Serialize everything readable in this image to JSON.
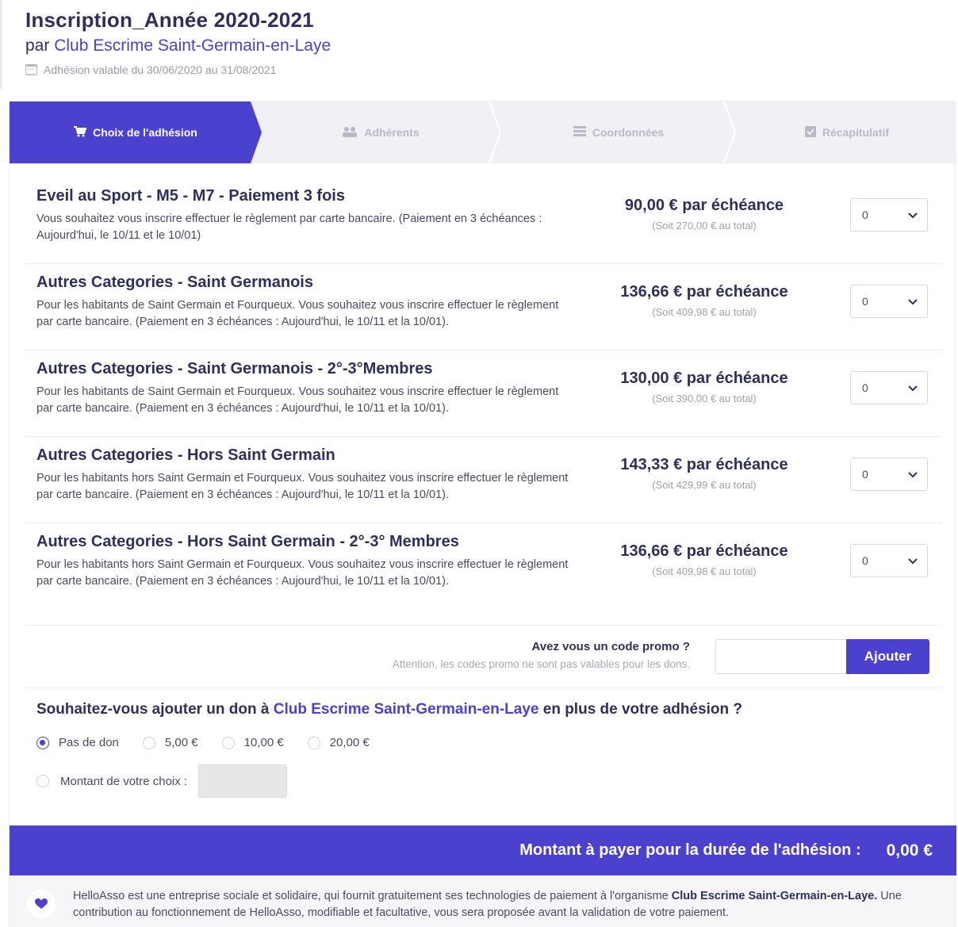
{
  "header": {
    "title": "Inscription_Année 2020-2021",
    "by": "par",
    "club": "Club Escrime Saint-Germain-en-Laye",
    "validity": "Adhésion valable du 30/06/2020 au 31/08/2021"
  },
  "steps": [
    {
      "label": "Choix de l'adhésion",
      "icon": "cart-icon"
    },
    {
      "label": "Adhérents",
      "icon": "users-icon"
    },
    {
      "label": "Coordonnées",
      "icon": "list-icon"
    },
    {
      "label": "Récapitulatif",
      "icon": "check-square-icon"
    }
  ],
  "items": [
    {
      "name": "Eveil au Sport - M5 - M7 - Paiement 3 fois",
      "desc": "Vous souhaitez vous inscrire effectuer le règlement par carte bancaire. (Paiement en 3 échéances : Aujourd'hui, le 10/11 et le 10/01)",
      "price": "90,00 € par échéance",
      "total": "(Soit 270,00 € au total)",
      "qty": "0"
    },
    {
      "name": "Autres Categories - Saint Germanois",
      "desc": "Pour les habitants de Saint Germain et Fourqueux. Vous souhaitez vous inscrire effectuer le règlement par carte bancaire. (Paiement en 3 échéances : Aujourd'hui, le 10/11 et la 10/01).",
      "price": "136,66 € par échéance",
      "total": "(Soit 409,98 € au total)",
      "qty": "0"
    },
    {
      "name": "Autres Categories - Saint Germanois - 2°-3°Membres",
      "desc": "Pour les habitants de Saint Germain et Fourqueux. Vous souhaitez vous inscrire effectuer le règlement par carte bancaire. (Paiement en 3 échéances : Aujourd'hui, le 10/11 et la 10/01).",
      "price": "130,00 € par échéance",
      "total": "(Soit 390,00 € au total)",
      "qty": "0"
    },
    {
      "name": "Autres Categories - Hors Saint Germain",
      "desc": "Pour les habitants hors Saint Germain et Fourqueux. Vous souhaitez vous inscrire effectuer le règlement par carte bancaire. (Paiement en 3 échéances : Aujourd'hui, le 10/11 et la 10/01).",
      "price": "143,33 € par échéance",
      "total": "(Soit 429,99 € au total)",
      "qty": "0"
    },
    {
      "name": "Autres Categories - Hors Saint Germain - 2°-3° Membres",
      "desc": "Pour les habitants hors Saint Germain et Fourqueux. Vous souhaitez vous inscrire effectuer le règlement par carte bancaire. (Paiement en 3 échéances : Aujourd'hui, le 10/11 et la 10/01).",
      "price": "136,66 € par échéance",
      "total": "(Soit 409,98 € au total)",
      "qty": "0"
    }
  ],
  "promo": {
    "question": "Avez vous un code promo ?",
    "warning": "Attention, les codes promo ne sont pas valables pour les dons.",
    "code_value": "",
    "add_label": "Ajouter"
  },
  "donation": {
    "question_before": "Souhaitez-vous ajouter un don à",
    "club": "Club Escrime Saint-Germain-en-Laye",
    "question_after": "en plus de votre adhésion ?",
    "options": [
      "Pas de don",
      "5,00 €",
      "10,00 €",
      "20,00 €"
    ],
    "selected": "Pas de don",
    "custom_label": "Montant de votre choix :",
    "custom_value": ""
  },
  "total": {
    "label": "Montant à payer pour la durée de l'adhésion :",
    "value": "0,00 €"
  },
  "info": {
    "text_before": "HelloAsso est une entreprise sociale et solidaire, qui fournit gratuitement ses technologies de paiement à l'organisme",
    "club": "Club Escrime Saint-Germain-en-Laye.",
    "text_after": "Une contribution au fonctionnement de HelloAsso, modifiable et facultative, vous sera proposée avant la validation de votre paiement."
  },
  "colors": {
    "accent": "#4c40cf",
    "text": "#2e2f5e",
    "muted": "#a0a0b0"
  }
}
